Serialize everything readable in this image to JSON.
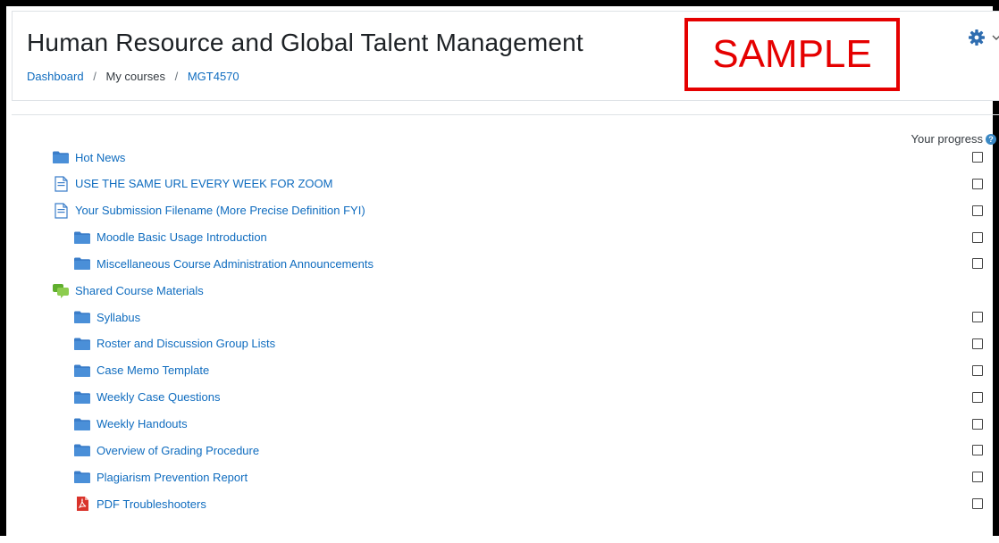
{
  "header": {
    "title": "Human Resource and Global Talent Management",
    "breadcrumb": [
      {
        "label": "Dashboard",
        "link": true
      },
      {
        "label": "My courses",
        "link": false
      },
      {
        "label": "MGT4570",
        "link": true
      }
    ],
    "breadcrumb_sep": "/",
    "watermark": "SAMPLE"
  },
  "progress": {
    "label": "Your progress",
    "help_glyph": "?"
  },
  "activities": [
    {
      "label": "Hot News",
      "icon": "folder-icon",
      "indent": 0,
      "checkbox": true
    },
    {
      "label": "USE THE SAME URL EVERY WEEK FOR ZOOM",
      "icon": "page-icon",
      "indent": 0,
      "checkbox": true
    },
    {
      "label": "Your Submission Filename (More Precise Definition FYI)",
      "icon": "page-icon",
      "indent": 0,
      "checkbox": true
    },
    {
      "label": "Moodle Basic Usage Introduction",
      "icon": "folder-icon",
      "indent": 1,
      "checkbox": true
    },
    {
      "label": "Miscellaneous Course Administration Announcements",
      "icon": "folder-icon",
      "indent": 1,
      "checkbox": true
    },
    {
      "label": "Shared Course Materials",
      "icon": "forum-icon",
      "indent": 0,
      "checkbox": false
    },
    {
      "label": "Syllabus",
      "icon": "folder-icon",
      "indent": 1,
      "checkbox": true
    },
    {
      "label": "Roster and Discussion Group Lists",
      "icon": "folder-icon",
      "indent": 1,
      "checkbox": true
    },
    {
      "label": "Case Memo Template",
      "icon": "folder-icon",
      "indent": 1,
      "checkbox": true
    },
    {
      "label": "Weekly Case Questions",
      "icon": "folder-icon",
      "indent": 1,
      "checkbox": true
    },
    {
      "label": "Weekly Handouts",
      "icon": "folder-icon",
      "indent": 1,
      "checkbox": true
    },
    {
      "label": "Overview of Grading Procedure",
      "icon": "folder-icon",
      "indent": 1,
      "checkbox": true
    },
    {
      "label": "Plagiarism Prevention Report",
      "icon": "folder-icon",
      "indent": 1,
      "checkbox": true
    },
    {
      "label": "PDF Troubleshooters",
      "icon": "pdf-icon",
      "indent": 1,
      "checkbox": true
    }
  ],
  "colors": {
    "link": "#0f6cbf",
    "folder": "#3a7dc9",
    "watermark": "#e50000",
    "gear": "#2f6db0"
  }
}
